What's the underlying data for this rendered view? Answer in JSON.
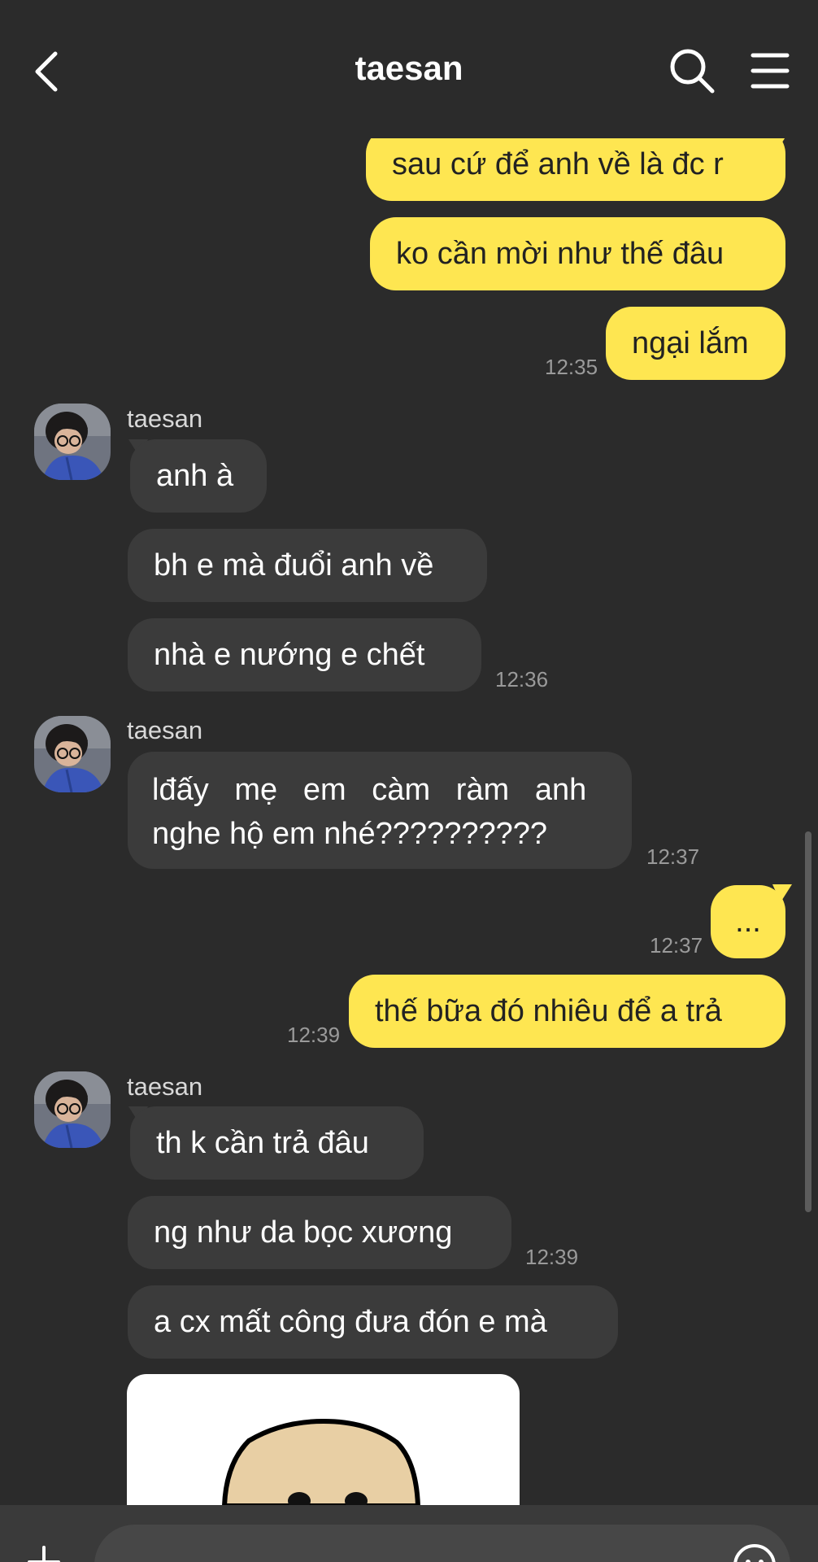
{
  "header": {
    "title": "taesan"
  },
  "messages": {
    "m1": "sau cứ để anh về là đc r",
    "m2": "ko cần mời như thế đâu",
    "m3": "ngại lắm",
    "t1": "12:35",
    "s1": "taesan",
    "m4": "anh à",
    "m5": "bh e mà đuổi anh về",
    "m6": "nhà e nướng e chết",
    "t2": "12:36",
    "s2": "taesan",
    "m7_line1": "lđấy   mẹ   em   càm   ràm   anh",
    "m7_line2": "nghe hộ em nhé??????????",
    "t3": "12:37",
    "m8": "...",
    "t4": "12:37",
    "m9": "thế bữa đó nhiêu để a trả",
    "t5": "12:39",
    "s3": "taesan",
    "m10": "th k cần trả đâu",
    "m11": "ng như da bọc xương",
    "t6": "12:39",
    "m12": "a cx mất công đưa đón e mà"
  },
  "colors": {
    "outgoing": "#fee651",
    "incoming": "#3b3b3b",
    "background": "#2b2b2b"
  },
  "icons": [
    "back-arrow-icon",
    "search-icon",
    "menu-icon",
    "plus-icon",
    "emoji-icon"
  ]
}
